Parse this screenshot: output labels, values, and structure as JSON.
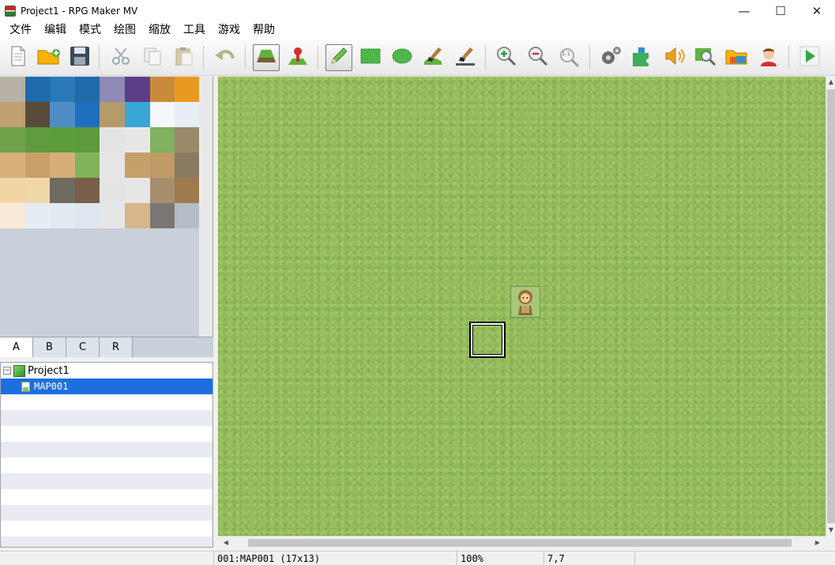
{
  "window": {
    "title": "Project1 - RPG Maker MV",
    "minimize_glyph": "—",
    "maximize_glyph": "☐",
    "close_glyph": "✕"
  },
  "menu": [
    "文件",
    "编辑",
    "模式",
    "绘图",
    "缩放",
    "工具",
    "游戏",
    "帮助"
  ],
  "toolbar": {
    "buttons": [
      {
        "name": "new-project-icon"
      },
      {
        "name": "open-project-icon"
      },
      {
        "name": "save-project-icon"
      },
      {
        "name": "cut-icon"
      },
      {
        "name": "copy-icon"
      },
      {
        "name": "paste-icon"
      },
      {
        "name": "undo-icon"
      },
      {
        "name": "map-mode-icon",
        "active": true
      },
      {
        "name": "event-mode-icon"
      },
      {
        "name": "pencil-icon",
        "active": true
      },
      {
        "name": "rectangle-icon"
      },
      {
        "name": "ellipse-icon"
      },
      {
        "name": "fill-icon"
      },
      {
        "name": "shadow-pen-icon"
      },
      {
        "name": "zoom-in-icon"
      },
      {
        "name": "zoom-out-icon"
      },
      {
        "name": "actual-size-icon"
      },
      {
        "name": "database-icon"
      },
      {
        "name": "plugin-manager-icon"
      },
      {
        "name": "sound-test-icon"
      },
      {
        "name": "event-searcher-icon"
      },
      {
        "name": "resource-manager-icon"
      },
      {
        "name": "character-generator-icon"
      },
      {
        "name": "playtest-icon"
      }
    ],
    "actual_size_label": "1:1"
  },
  "tileset_tabs": {
    "items": [
      "A",
      "B",
      "C",
      "R"
    ],
    "active": "A"
  },
  "tileset_palette": {
    "rows": [
      [
        "#b6b0a6",
        "#1f6aa8",
        "#2a78b8",
        "#1f6aa8",
        "#8f8ab6",
        "#5a3f88",
        "#c98a3c",
        "#e99a1e"
      ],
      [
        "#c0a070",
        "#5a4a3a",
        "#4f8cc6",
        "#1e6fc0",
        "#b59a6a",
        "#3aa6d6",
        "#f4f8fc",
        "#e8eef4"
      ],
      [
        "#6fa24a",
        "#5f9b3f",
        "#5c9c3c",
        "#5c9a3d",
        "#e4e4e4",
        "#e6e6e6",
        "#80b060",
        "#9a8a6a"
      ],
      [
        "#d9b07a",
        "#c9a06a",
        "#d5ae7a",
        "#7fb458",
        "#e6e6e6",
        "#c6a06a",
        "#c09a66",
        "#8a7a62"
      ],
      [
        "#f1d5a4",
        "#f0d7a8",
        "#6e6a62",
        "#7a5e4a",
        "#e4e4e4",
        "#e6e6e6",
        "#a68e6e",
        "#9e7a4e"
      ],
      [
        "#f7ead8",
        "#e6ecf4",
        "#e4eaf2",
        "#dfe6f0",
        "#e6e6e6",
        "#d6b68a",
        "#7a7672",
        "#b4bcc8"
      ]
    ]
  },
  "map_tree": {
    "project": "Project1",
    "maps": [
      "MAP001"
    ],
    "selected": "MAP001",
    "expander_glyph": "−"
  },
  "map_view": {
    "tile_color": "#93bb5c",
    "has_event": true,
    "cursor_tile": [
      7,
      7
    ]
  },
  "status": {
    "map": "001:MAP001 (17x13)",
    "zoom": "100%",
    "coords": "7,7"
  }
}
